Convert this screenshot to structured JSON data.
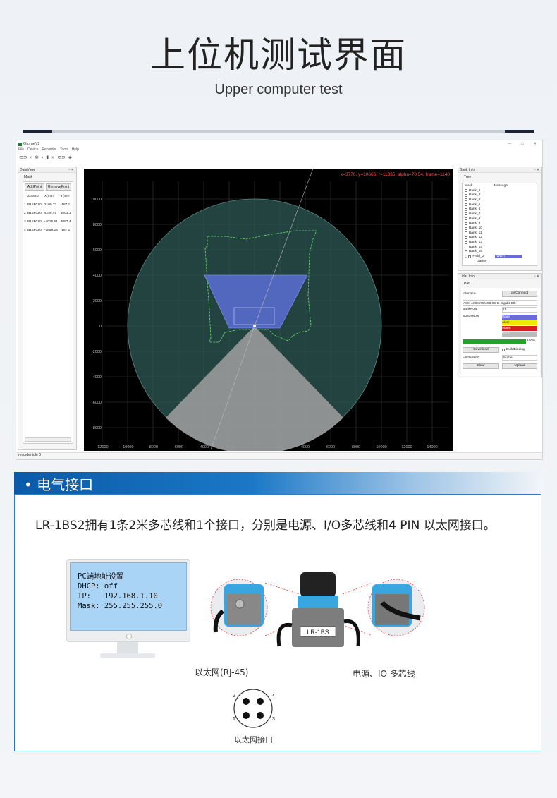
{
  "header": {
    "title": "上位机测试界面",
    "subtitle": "Upper computer test"
  },
  "app": {
    "window_title": "QforgeV2",
    "window_controls": [
      "—",
      "□",
      "✕"
    ],
    "menu": [
      "File",
      "Device",
      "Recorder",
      "Tools",
      "Help"
    ],
    "dataview": {
      "title": "DataView",
      "tab": "Mask",
      "add_button": "AddPoint",
      "remove_button": "RemovePoint",
      "columns": [
        "ZoneID",
        "X(mm)",
        "Y(mm"
      ],
      "rows": [
        [
          "1",
          "B15F0Z0",
          "2100.77",
          "-187.1"
        ],
        [
          "2",
          "B15F0Z0",
          "4159.45",
          "4001.1"
        ],
        [
          "3",
          "B15F0Z0",
          "-4015.51",
          "4087.4"
        ],
        [
          "4",
          "B15F0Z0",
          "-1899.23",
          "-187.1"
        ]
      ]
    },
    "plot": {
      "readout": "x=3776, y=10666, r=11335, alpha=70.54, frame=1140",
      "y_ticks": [
        "10000",
        "8000",
        "6000",
        "4000",
        "2000",
        "0",
        "-2000",
        "-4000",
        "-6000",
        "-8000"
      ],
      "x_ticks": [
        "-12000",
        "-10000",
        "-8000",
        "-6000",
        "-4000",
        "-2000",
        "0",
        "2000",
        "4000",
        "6000",
        "8000",
        "10000",
        "12000",
        "14000"
      ]
    },
    "bank_info": {
      "title": "Bank Info",
      "tab": "Tree",
      "col_mask": "Mask",
      "col_message": "Message",
      "items": [
        "Bank_2",
        "Bank_3",
        "Bank_4",
        "Bank_5",
        "Bank_6",
        "Bank_7",
        "Bank_8",
        "Bank_9",
        "Bank_10",
        "Bank_11",
        "Bank_12",
        "Bank_13",
        "Bank_14",
        "Bank_15"
      ],
      "field": "Field_0",
      "field_msg": "Warn",
      "sub": "Gather"
    },
    "lidar_info": {
      "title": "Lidar Info",
      "tab": "Pad",
      "interface_label": "Interface",
      "disconnect": "disConnect",
      "adapter": "ASIX AX88179 USB 3.0 to Gigabit Eth~",
      "banknow_label": "BankNow",
      "banknow_value": "15",
      "statusnow_label": "StatusNow",
      "status_items": [
        "Warn",
        "Alert",
        "Alarm",
        "Error"
      ],
      "progress": "100%",
      "progress_value": 1.0,
      "download": "Download",
      "buildbinding": "BuildBinding",
      "livegraphy_label": "LiveGraphy",
      "livegraphy_value": "Scatter",
      "clear": "Clear",
      "upload": "Upload"
    },
    "status_bar": "recorder idle  0"
  },
  "section": {
    "heading": "• 电气接口",
    "description": "LR-1BS2拥有1条2米多芯线和1个接口，分别是电源、I/O多芯线和4 PIN 以太网接口。",
    "pc_settings": {
      "title": "PC端地址设置",
      "dhcp": "DHCP: off",
      "ip": "IP:   192.168.1.10",
      "mask": "Mask: 255.255.255.0"
    },
    "device_label": "LR-1BS",
    "caption_ethernet": "以太网(RJ-45)",
    "caption_power": "电源、IO 多芯线",
    "pin_labels": [
      "2",
      "4",
      "1",
      "3"
    ],
    "caption_connector": "以太网接口"
  },
  "colors": {
    "accent": "#1b78c7",
    "plot_bg": "#000000",
    "zone_fill": "#5a6fd6",
    "warn": "#6b6bd8",
    "alert": "#f0e800",
    "alarm": "#d42020",
    "progress": "#22a32a"
  }
}
